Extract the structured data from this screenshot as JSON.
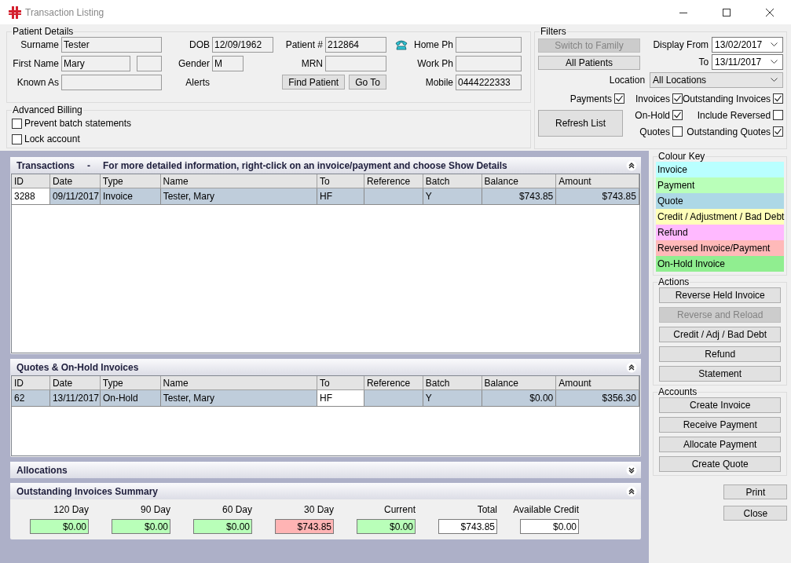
{
  "window": {
    "title": "Transaction Listing"
  },
  "patient_details": {
    "title": "Patient Details",
    "rows": [
      [
        {
          "kind": "field",
          "label": "Surname",
          "value": "Tester"
        },
        {
          "kind": "field",
          "label": "DOB",
          "value": "12/09/1962"
        },
        {
          "kind": "field",
          "label": "Patient #",
          "value": "212864"
        },
        {
          "kind": "icon_field",
          "label": "Home Ph"
        }
      ],
      [
        {
          "kind": "split_field",
          "label": "First Name",
          "value": "Mary"
        },
        {
          "kind": "short_field",
          "label": "Gender",
          "value": "M"
        },
        {
          "kind": "field",
          "label": "MRN"
        },
        {
          "kind": "field",
          "label": "Work Ph"
        }
      ],
      [
        {
          "kind": "field",
          "label": "Known As"
        },
        {
          "kind": "label",
          "label": "Alerts"
        },
        {
          "kind": "buttons",
          "buttons": [
            "Find Patient",
            "Go To"
          ]
        },
        {
          "kind": "field",
          "label": "Mobile",
          "value": "0444222333"
        }
      ]
    ]
  },
  "advanced_billing": {
    "title": "Advanced Billing",
    "options": [
      {
        "label": "Prevent batch statements",
        "checked": false
      },
      {
        "label": "Lock account",
        "checked": false
      }
    ]
  },
  "filters": {
    "title": "Filters",
    "buttons": [
      {
        "label": "Switch to Family",
        "disabled": true
      },
      {
        "label": "All Patients",
        "disabled": false
      }
    ],
    "dates": [
      {
        "label": "Display From",
        "value": "13/02/2017"
      },
      {
        "label": "To",
        "value": "13/11/2017"
      }
    ],
    "location": {
      "label": "Location",
      "value": "All Locations"
    },
    "checkboxes": [
      {
        "label": "Payments",
        "checked": true
      },
      {
        "label": "Invoices",
        "checked": true
      },
      {
        "label": "Outstanding Invoices",
        "checked": true
      },
      {
        "label": "On-Hold",
        "checked": true
      },
      {
        "label": "Include Reversed",
        "checked": false
      },
      {
        "label": "Quotes",
        "checked": false
      },
      {
        "label": "Outstanding Quotes",
        "checked": true
      }
    ],
    "refresh_button": "Refresh List"
  },
  "tables": [
    {
      "title": "Transactions",
      "separator": "-",
      "note": "For more detailed information, right-click on an invoice/payment and choose Show Details",
      "expanded": true,
      "columns": [
        {
          "label": "ID"
        },
        {
          "label": "Date"
        },
        {
          "label": "Type"
        },
        {
          "label": "Name"
        },
        {
          "label": "To"
        },
        {
          "label": "Reference"
        },
        {
          "label": "Batch"
        },
        {
          "label": "Balance"
        },
        {
          "label": "Amount"
        }
      ],
      "rows": [
        {
          "selected": true,
          "cells": [
            {
              "text": "3288",
              "focused": true
            },
            {
              "text": "09/11/2017",
              "focused": false
            },
            {
              "text": "Invoice",
              "focused": false
            },
            {
              "text": "Tester, Mary",
              "focused": false
            },
            {
              "text": "HF",
              "focused": false
            },
            {
              "focused": false
            },
            {
              "text": "Y",
              "focused": false
            },
            {
              "text": "$743.85",
              "focused": false
            },
            {
              "text": "$743.85",
              "focused": false
            }
          ]
        }
      ]
    },
    {
      "title": "Quotes & On-Hold Invoices",
      "expanded": true,
      "columns": [
        {
          "label": "ID"
        },
        {
          "label": "Date"
        },
        {
          "label": "Type"
        },
        {
          "label": "Name"
        },
        {
          "label": "To"
        },
        {
          "label": "Reference"
        },
        {
          "label": "Batch"
        },
        {
          "label": "Balance"
        },
        {
          "label": "Amount"
        }
      ],
      "rows": [
        {
          "selected": true,
          "cells": [
            {
              "text": "62",
              "focused": false
            },
            {
              "text": "13/11/2017",
              "focused": false
            },
            {
              "text": "On-Hold",
              "focused": false
            },
            {
              "text": "Tester, Mary",
              "focused": false
            },
            {
              "text": "HF",
              "focused": true
            },
            {
              "focused": false
            },
            {
              "text": "Y",
              "focused": false
            },
            {
              "text": "$0.00",
              "focused": false
            },
            {
              "text": "$356.30",
              "focused": false
            }
          ]
        }
      ]
    }
  ],
  "allocations": {
    "title": "Allocations",
    "expanded": false
  },
  "summary": {
    "title": "Outstanding Invoices Summary",
    "expanded": true,
    "items": [
      {
        "label": "120 Day",
        "value": "$0.00",
        "color": "#b9ffb9"
      },
      {
        "label": "90 Day",
        "value": "$0.00",
        "color": "#b9ffb9"
      },
      {
        "label": "60 Day",
        "value": "$0.00",
        "color": "#b9ffb9"
      },
      {
        "label": "30 Day",
        "value": "$743.85",
        "color": "#ffb4b4"
      },
      {
        "label": "Current",
        "value": "$0.00",
        "color": "#b9ffb9"
      },
      {
        "label": "Total",
        "value": "$743.85",
        "color": "#ffffff"
      },
      {
        "label": "Available Credit",
        "value": "$0.00",
        "color": "#ffffff"
      }
    ]
  },
  "colour_key": {
    "title": "Colour Key",
    "items": [
      {
        "label": "Invoice",
        "color": "#b9ffff"
      },
      {
        "label": "Payment",
        "color": "#b9ffb9"
      },
      {
        "label": "Quote",
        "color": "#add8e6"
      },
      {
        "label": "Credit / Adjustment / Bad Debt",
        "color": "#ffffb9"
      },
      {
        "label": "Refund",
        "color": "#ffb9ff"
      },
      {
        "label": "Reversed Invoice/Payment",
        "color": "#ffb9b9"
      },
      {
        "label": "On-Hold Invoice",
        "color": "#90ee90"
      }
    ]
  },
  "actions": {
    "title": "Actions",
    "buttons": [
      {
        "label": "Reverse Held Invoice",
        "disabled": false
      },
      {
        "label": "Reverse and Reload",
        "disabled": true
      },
      {
        "label": "Credit / Adj / Bad Debt",
        "disabled": false
      },
      {
        "label": "Refund",
        "disabled": false
      },
      {
        "label": "Statement",
        "disabled": false
      }
    ]
  },
  "accounts": {
    "title": "Accounts",
    "buttons": [
      {
        "label": "Create Invoice",
        "disabled": false
      },
      {
        "label": "Receive Payment",
        "disabled": false
      },
      {
        "label": "Allocate Payment",
        "disabled": false
      },
      {
        "label": "Create Quote",
        "disabled": false
      }
    ]
  },
  "footer_buttons": [
    "Print",
    "Close"
  ]
}
